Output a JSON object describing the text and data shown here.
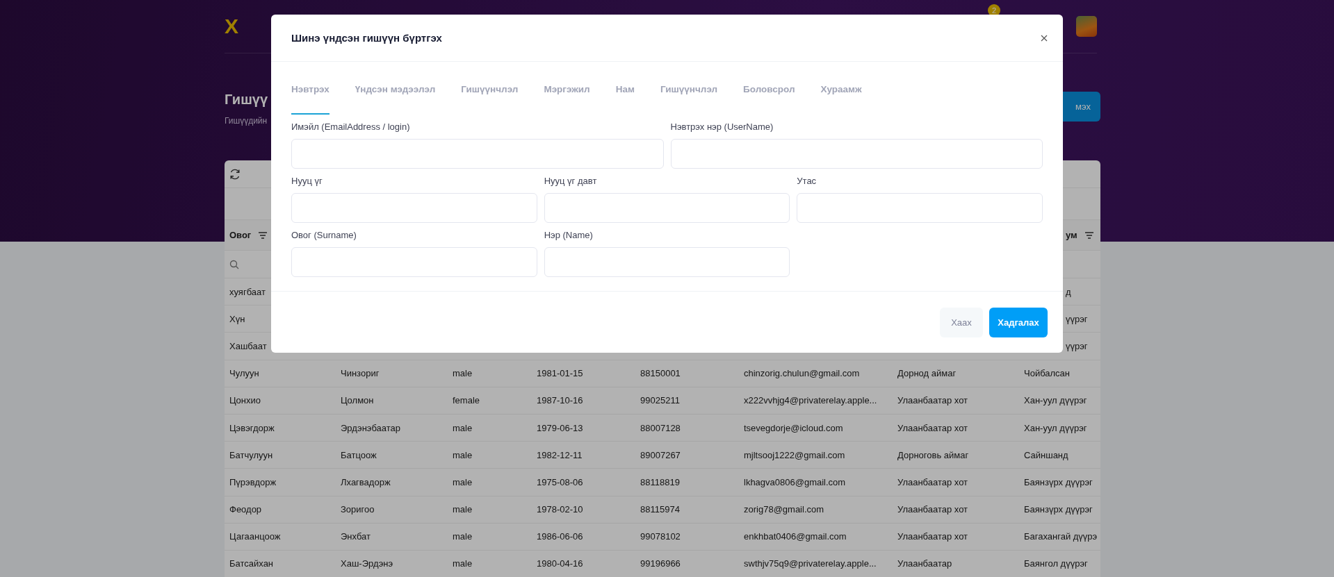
{
  "header": {
    "logo": "X",
    "notification_count": "2"
  },
  "page": {
    "title": "Гишүү",
    "subtitle": "Гишүүдийн",
    "add_button": "мэх"
  },
  "table": {
    "columns": [
      {
        "label": "Овог"
      },
      {
        "label": "ум"
      }
    ],
    "rows": [
      {
        "kind": "covered",
        "cells": [
          "хуягбаат",
          "д"
        ]
      },
      {
        "kind": "covered",
        "cells": [
          "Хүн",
          "үүрэг"
        ]
      },
      {
        "kind": "covered",
        "cells": [
          "Хашбаат",
          "үүрэг"
        ]
      },
      {
        "kind": "full",
        "cells": [
          "Чулуун",
          "Чинзориг",
          "male",
          "1981-01-15",
          "88150001",
          "chinzorig.chulun@gmail.com",
          "Дорнод аймаг",
          "Чойбалсан"
        ]
      },
      {
        "kind": "full",
        "cells": [
          "Цонхио",
          "Цолмон",
          "female",
          "1987-10-16",
          "99025211",
          "x222vvhjg4@privaterelay.apple...",
          "Улаанбаатар хот",
          "Хан-уул дүүрэг"
        ]
      },
      {
        "kind": "full",
        "cells": [
          "Цэвэгдорж",
          "Эрдэнэбаатар",
          "male",
          "1979-06-13",
          "88007128",
          "tsevegdorje@icloud.com",
          "Улаанбаатар хот",
          "Хан-уул дүүрэг"
        ]
      },
      {
        "kind": "full",
        "cells": [
          "Батчулуун",
          "Батцоож",
          "male",
          "1982-12-11",
          "89007267",
          "mjltsooj1222@gmail.com",
          "Дорноговь аймаг",
          "Сайншанд"
        ]
      },
      {
        "kind": "full",
        "cells": [
          "Пүрэвдорж",
          "Лхагвадорж",
          "male",
          "1975-08-06",
          "88118819",
          "lkhagva0806@gmail.com",
          "Улаанбаатар хот",
          "Баянзүрх дүүрэг"
        ]
      },
      {
        "kind": "full",
        "cells": [
          "Феодор",
          "Зоригоо",
          "male",
          "1978-02-10",
          "88115974",
          "zorig78@gmail.com",
          "Улаанбаатар хот",
          "Баянзүрх дүүрэг"
        ]
      },
      {
        "kind": "full",
        "cells": [
          "Цагаанцоож",
          "Энхбат",
          "male",
          "1986-06-06",
          "99078102",
          "enkhbat0406@gmail.com",
          "Улаанбаатар хот",
          "Багахангай дүүрэ"
        ]
      },
      {
        "kind": "full",
        "cells": [
          "Батсайхан",
          "Хаш-Эрдэнэ",
          "male",
          "1980-04-16",
          "99196966",
          "swthjv75q9@privaterelay.apple...",
          "Улаанбаатар",
          "Баянгол дүүрэг"
        ]
      }
    ]
  },
  "modal": {
    "title": "Шинэ үндсэн гишүүн бүртгэх",
    "tabs": [
      {
        "label": "Нэвтрэх",
        "selected": true
      },
      {
        "label": "Үндсэн мэдээлэл",
        "selected": false
      },
      {
        "label": "Гишүүнчлэл",
        "selected": false
      },
      {
        "label": "Мэргэжил",
        "selected": false
      },
      {
        "label": "Нам",
        "selected": false
      },
      {
        "label": "Гишүүнчлэл",
        "selected": false
      },
      {
        "label": "Боловсрол",
        "selected": false
      },
      {
        "label": "Хураамж",
        "selected": false
      }
    ],
    "field_rows": [
      {
        "fields": [
          {
            "label": "Имэйл (EmailAddress / login)"
          },
          {
            "label": "Нэвтрэх нэр (UserName)"
          }
        ]
      },
      {
        "fields": [
          {
            "label": "Нууц үг"
          },
          {
            "label": "Нууц үг давт"
          },
          {
            "label": "Утас"
          }
        ]
      },
      {
        "fields": [
          {
            "label": "Овог (Surname)"
          },
          {
            "label": "Нэр (Name)"
          }
        ]
      }
    ],
    "buttons": {
      "cancel": "Хаах",
      "save": "Хадгалах"
    }
  }
}
